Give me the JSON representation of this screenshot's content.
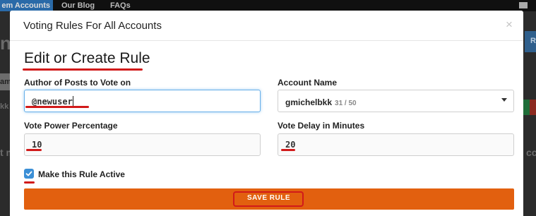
{
  "nav": {
    "items": [
      "em Accounts",
      "Our Blog",
      "FAQs"
    ],
    "mail_icon": "envelope-icon"
  },
  "background": {
    "heading_fragment": "n /",
    "row_label_fragment_1": "ame",
    "row_label_fragment_2": "kk",
    "left_fragment": "t m",
    "right_fragment": "cc",
    "right_button_fragment": "R"
  },
  "modal": {
    "title": "Voting Rules For All Accounts",
    "close_glyph": "×",
    "section_title": "Edit or Create Rule",
    "author_label": "Author of Posts to Vote on",
    "author_value": "@newuser",
    "account_label": "Account Name",
    "account_value": "gmichelbkk",
    "account_count": "31 / 50",
    "power_label": "Vote Power Percentage",
    "power_value": "10",
    "delay_label": "Vote Delay in Minutes",
    "delay_value": "20",
    "active_label": "Make this Rule Active",
    "active_checked": true,
    "save_label": "SAVE RULE"
  },
  "colors": {
    "accent_orange": "#e2600f",
    "annotation_red": "#d11a1a",
    "checkbox_blue": "#3b8fd6",
    "nav_active": "#2a6aa8"
  }
}
